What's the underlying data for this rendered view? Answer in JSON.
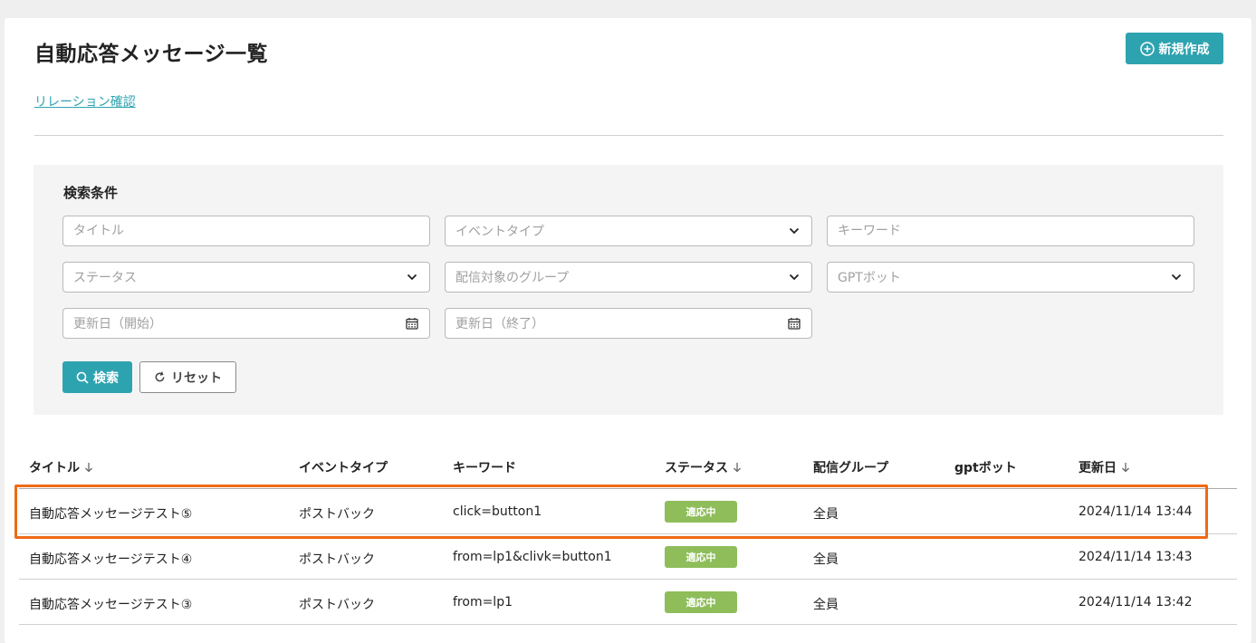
{
  "header": {
    "title": "自動応答メッセージ一覧",
    "new_button_label": "新規作成",
    "relation_link": "リレーション確認"
  },
  "search": {
    "panel_title": "検索条件",
    "title_placeholder": "タイトル",
    "event_type_placeholder": "イベントタイプ",
    "keyword_placeholder": "キーワード",
    "status_placeholder": "ステータス",
    "group_placeholder": "配信対象のグループ",
    "gpt_bot_placeholder": "GPTボット",
    "updated_from_placeholder": "更新日（開始）",
    "updated_to_placeholder": "更新日（終了）",
    "search_button": "検索",
    "reset_button": "リセット"
  },
  "table": {
    "columns": {
      "title": "タイトル",
      "event_type": "イベントタイプ",
      "keyword": "キーワード",
      "status": "ステータス",
      "group": "配信グループ",
      "gpt_bot": "gptボット",
      "updated": "更新日"
    },
    "rows": [
      {
        "title": "自動応答メッセージテスト⑤",
        "event_type": "ポストバック",
        "keyword": "click=button1",
        "status": "適応中",
        "group": "全員",
        "gpt_bot": "",
        "updated": "2024/11/14 13:44"
      },
      {
        "title": "自動応答メッセージテスト④",
        "event_type": "ポストバック",
        "keyword": "from=lp1&clivk=button1",
        "status": "適応中",
        "group": "全員",
        "gpt_bot": "",
        "updated": "2024/11/14 13:43"
      },
      {
        "title": "自動応答メッセージテスト③",
        "event_type": "ポストバック",
        "keyword": "from=lp1",
        "status": "適応中",
        "group": "全員",
        "gpt_bot": "",
        "updated": "2024/11/14 13:42"
      }
    ]
  },
  "colors": {
    "accent": "#2ea3b0",
    "status_active": "#8ebd5a",
    "highlight": "#ee6a16"
  },
  "icons": {
    "new_button": "plus-circle-icon",
    "dropdown": "chevron-down-icon",
    "date": "calendar-icon",
    "search": "search-icon",
    "reset": "refresh-icon",
    "sort": "arrow-down-icon"
  }
}
